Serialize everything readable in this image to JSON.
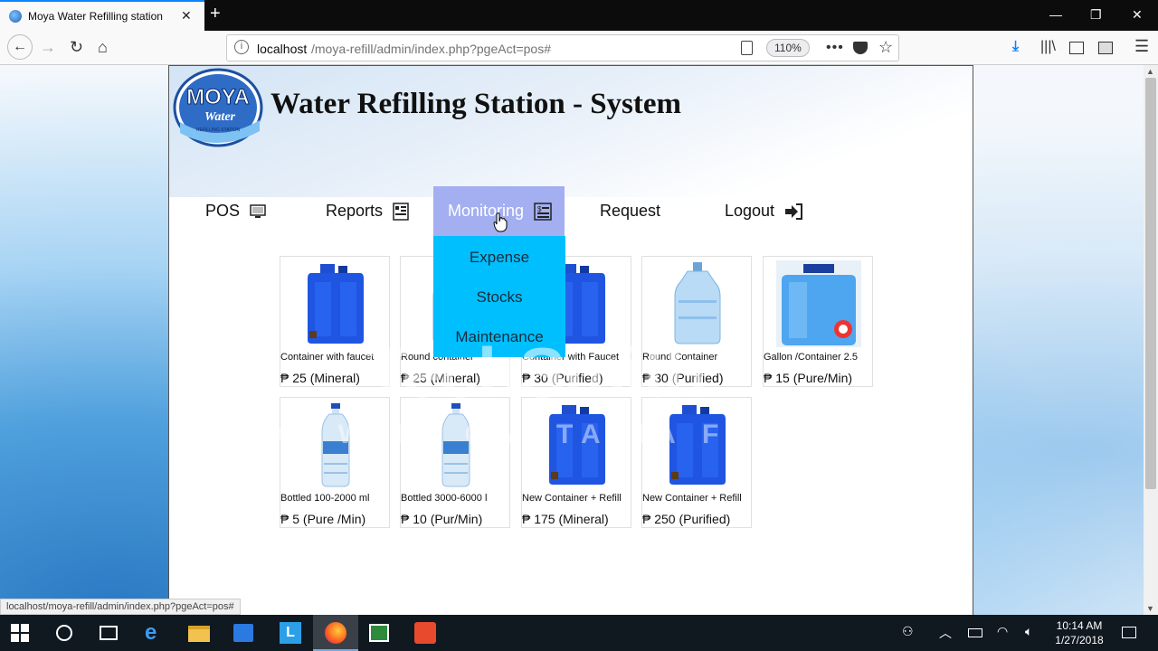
{
  "browser": {
    "tab_title": "Moya Water Refilling station",
    "url_host": "localhost",
    "url_path": "/moya-refill/admin/index.php?pgeAct=pos#",
    "zoom": "110%",
    "status_url": "localhost/moya-refill/admin/index.php?pgeAct=pos#"
  },
  "header": {
    "logo_text_main": "MOYA",
    "logo_text_sub": "Water",
    "logo_text_tag": "REFILLING STATION",
    "title": "Water Refilling Station - System"
  },
  "menu": {
    "pos": "POS",
    "reports": "Reports",
    "monitoring": "Monitoring",
    "request": "Request",
    "logout": "Logout"
  },
  "dropdown": [
    "Expense",
    "Stocks",
    "Maintenance"
  ],
  "products": [
    {
      "name": "Container with faucet",
      "price": "₱ 25 (Mineral)",
      "kind": "jug"
    },
    {
      "name": "Round container",
      "price": "₱ 25 (Mineral)",
      "kind": "round"
    },
    {
      "name": "Container with Faucet",
      "price": "₱ 30 (Purified)",
      "kind": "jug"
    },
    {
      "name": "Round Container",
      "price": "₱ 30 (Purified)",
      "kind": "round"
    },
    {
      "name": "Gallon /Container 2.5",
      "price": "₱ 15 (Pure/Min)",
      "kind": "dispenser"
    },
    {
      "name": "Bottled 100-2000 ml",
      "price": "₱ 5 (Pure /Min)",
      "kind": "bottle"
    },
    {
      "name": "Bottled 3000-6000 l",
      "price": "₱ 10 (Pur/Min)",
      "kind": "bottle"
    },
    {
      "name": "New Container + Refill",
      "price": "₱ 175 (Mineral)",
      "kind": "jug"
    },
    {
      "name": "New Container + Refill",
      "price": "₱ 250 (Purified)",
      "kind": "jug"
    }
  ],
  "watermark": {
    "main": "TechSmith",
    "sub": "MADE WITH CAMTASIA FREE TRIAL"
  },
  "taskbar": {
    "time": "10:14 AM",
    "date": "1/27/2018"
  },
  "colors": {
    "menu_active": "#a3aff0",
    "dropdown": "#00bfff",
    "firefox_blue": "#0a84ff"
  }
}
